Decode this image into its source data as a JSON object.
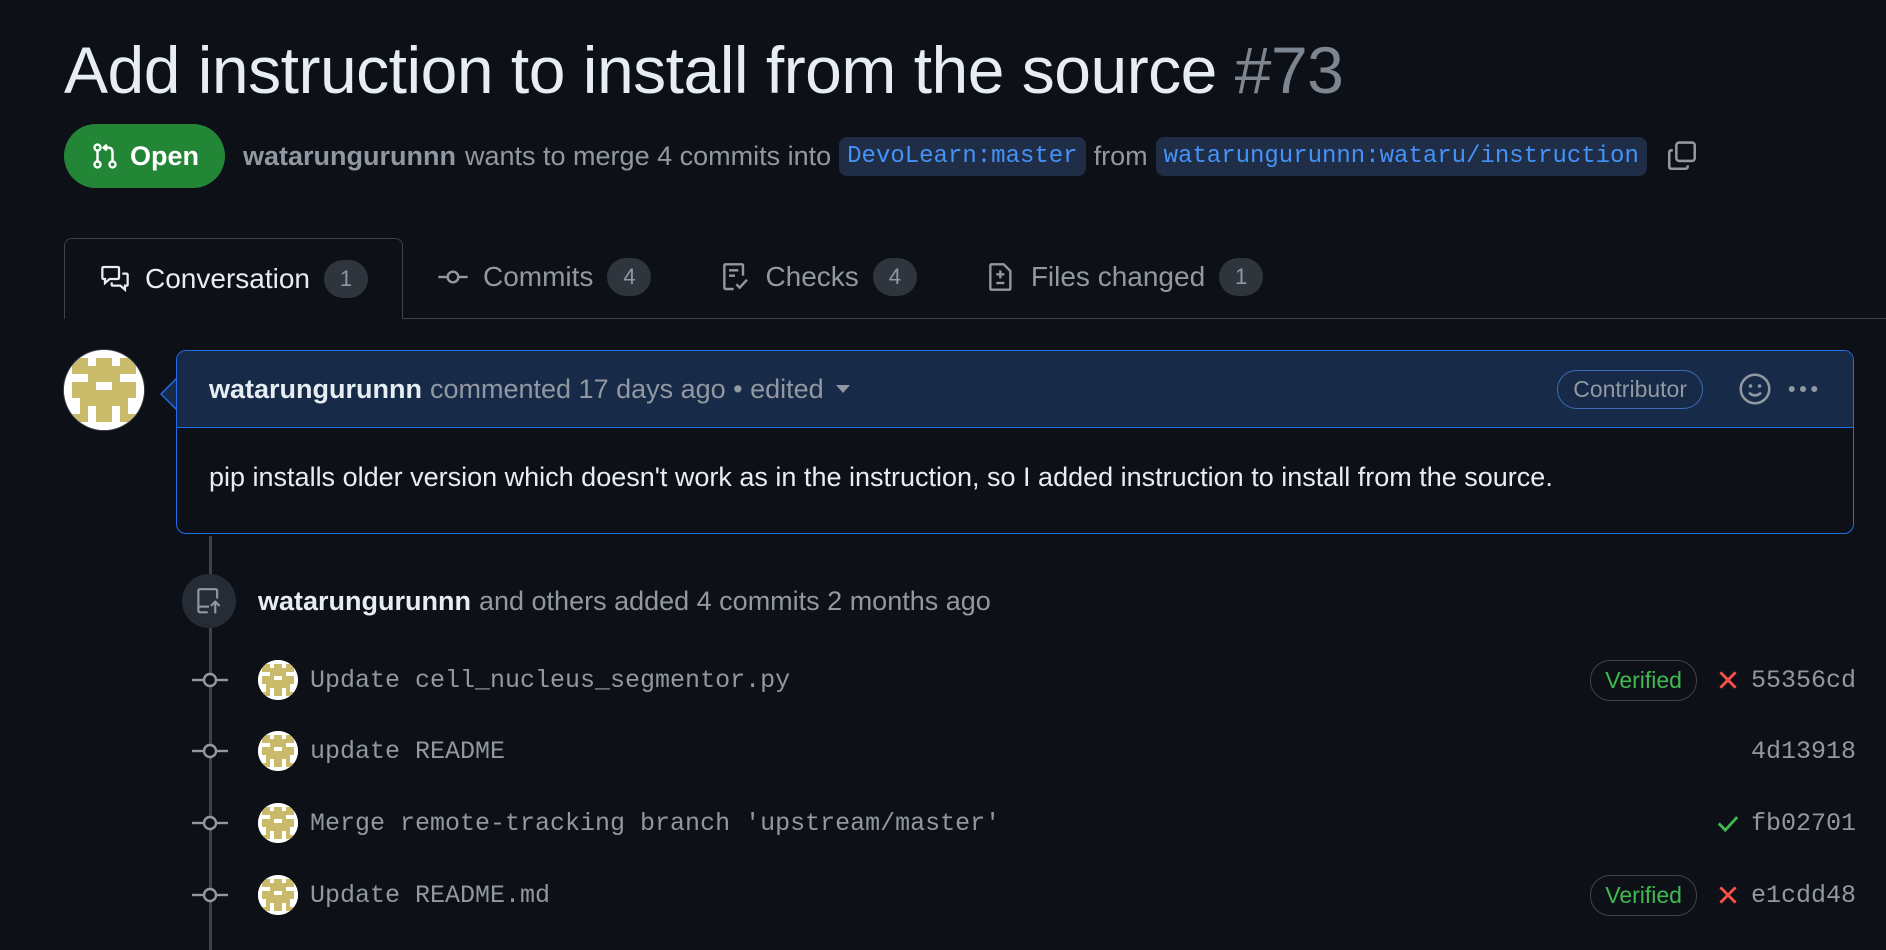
{
  "pr": {
    "title": "Add instruction to install from the source",
    "number": "#73",
    "state": "Open",
    "author": "watarungurunnn",
    "merge_text_1": "wants to merge 4 commits into",
    "base_branch": "DevoLearn:master",
    "merge_text_2": "from",
    "head_branch": "watarungurunnn:wataru/instruction"
  },
  "tabs": [
    {
      "label": "Conversation",
      "count": "1",
      "icon": "comment-discussion-icon"
    },
    {
      "label": "Commits",
      "count": "4",
      "icon": "git-commit-icon"
    },
    {
      "label": "Checks",
      "count": "4",
      "icon": "checklist-icon"
    },
    {
      "label": "Files changed",
      "count": "1",
      "icon": "file-diff-icon"
    }
  ],
  "comment": {
    "author": "watarungurunnn",
    "meta": "commented 17 days ago • edited",
    "role": "Contributor",
    "body": "pip installs older version which doesn't work as in the instruction, so I added instruction to install from the source."
  },
  "push_event": {
    "author": "watarungurunnn",
    "text": "and others added 4 commits 2 months ago"
  },
  "commits": [
    {
      "message": "Update cell_nucleus_segmentor.py",
      "verified": "Verified",
      "status": "failure",
      "sha": "55356cd"
    },
    {
      "message": "update README",
      "verified": "",
      "status": "none",
      "sha": "4d13918"
    },
    {
      "message": "Merge remote-tracking branch 'upstream/master'",
      "verified": "",
      "status": "success",
      "sha": "fb02701"
    },
    {
      "message": "Update README.md",
      "verified": "Verified",
      "status": "failure",
      "sha": "e1cdd48"
    }
  ],
  "colors": {
    "open_green": "#238636",
    "success": "#3fb950",
    "failure": "#f85149",
    "accent_blue": "#1f6feb",
    "avatar": "#c9bb6a"
  }
}
